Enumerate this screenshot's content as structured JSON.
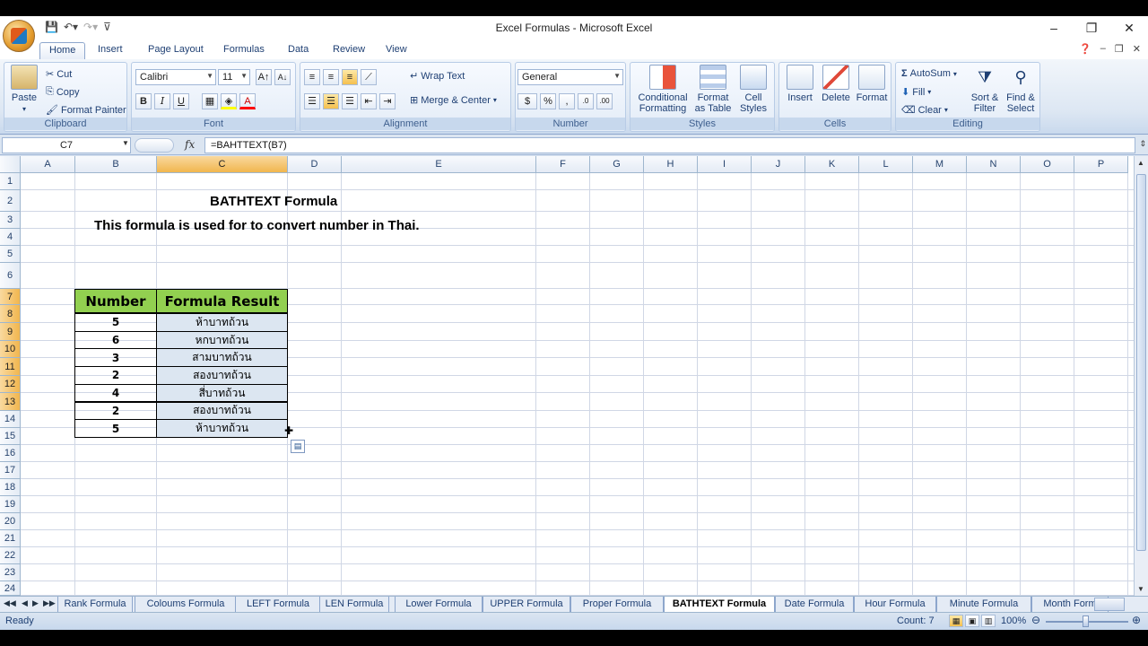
{
  "window": {
    "title": "Excel Formulas - Microsoft Excel",
    "controls": [
      "–",
      "❐",
      "✕"
    ]
  },
  "ribbon_tabs": [
    "Home",
    "Insert",
    "Page Layout",
    "Formulas",
    "Data",
    "Review",
    "View"
  ],
  "active_tab": "Home",
  "clipboard": {
    "paste": "Paste",
    "cut": "Cut",
    "copy": "Copy",
    "format_painter": "Format Painter",
    "label": "Clipboard"
  },
  "font": {
    "name": "Calibri",
    "size": "11",
    "bold": "B",
    "italic": "I",
    "underline": "U",
    "label": "Font"
  },
  "alignment": {
    "wrap_text": "Wrap Text",
    "merge_center": "Merge & Center",
    "label": "Alignment"
  },
  "number": {
    "format": "General",
    "currency": "$",
    "percent": "%",
    "comma": ",",
    "label": "Number"
  },
  "styles": {
    "conditional_1": "Conditional",
    "conditional_2": "Formatting",
    "format_table_1": "Format",
    "format_table_2": "as Table",
    "cell_styles_1": "Cell",
    "cell_styles_2": "Styles",
    "label": "Styles"
  },
  "cells": {
    "insert": "Insert",
    "delete": "Delete",
    "format": "Format",
    "label": "Cells"
  },
  "editing": {
    "autosum": "AutoSum",
    "fill": "Fill",
    "clear": "Clear",
    "sort_1": "Sort &",
    "sort_2": "Filter",
    "find_1": "Find &",
    "find_2": "Select",
    "label": "Editing"
  },
  "formula_bar": {
    "name_box": "C7",
    "fx": "fx",
    "formula": "=BAHTTEXT(B7)"
  },
  "columns": [
    "A",
    "B",
    "C",
    "D",
    "E",
    "F",
    "G",
    "H",
    "I",
    "J",
    "K",
    "L",
    "M",
    "N",
    "O",
    "P"
  ],
  "rows": [
    "1",
    "2",
    "3",
    "4",
    "5",
    "6",
    "7",
    "8",
    "9",
    "10",
    "11",
    "12",
    "13",
    "14",
    "15",
    "16",
    "17",
    "18",
    "19",
    "20",
    "21",
    "22",
    "23",
    "24"
  ],
  "sheet": {
    "title": "BATHTEXT Formula",
    "subtitle": "This formula is used for to convert number in Thai.",
    "table_headers": [
      "Number",
      "Formula Result"
    ],
    "table_rows": [
      {
        "number": "5",
        "result": "ห้าบาทถ้วน"
      },
      {
        "number": "6",
        "result": "หกบาทถ้วน"
      },
      {
        "number": "3",
        "result": "สามบาทถ้วน"
      },
      {
        "number": "2",
        "result": "สองบาทถ้วน"
      },
      {
        "number": "4",
        "result": "สี่บาทถ้วน"
      },
      {
        "number": "2",
        "result": "สองบาทถ้วน"
      },
      {
        "number": "5",
        "result": "ห้าบาทถ้วน"
      }
    ]
  },
  "sheet_tabs": [
    "Rank Formula",
    "Coloums Formula",
    "LEFT Formula",
    "LEN Formula",
    "Lower Formula",
    "UPPER Formula",
    "Proper Formula",
    "BATHTEXT Formula",
    "Date Formula",
    "Hour Formula",
    "Minute Formula",
    "Month Form"
  ],
  "active_sheet": "BATHTEXT Formula",
  "status": {
    "ready": "Ready",
    "count": "Count: 7",
    "zoom": "100%"
  }
}
